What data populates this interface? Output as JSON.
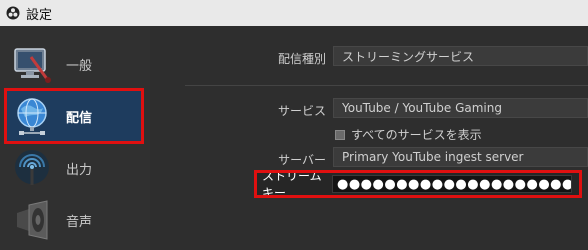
{
  "window": {
    "title": "設定"
  },
  "sidebar": {
    "items": [
      {
        "label": "一般",
        "icon": "monitor-icon"
      },
      {
        "label": "配信",
        "icon": "globe-network-icon",
        "selected": true
      },
      {
        "label": "出力",
        "icon": "broadcast-antenna-icon"
      },
      {
        "label": "音声",
        "icon": "speaker-icon"
      }
    ]
  },
  "stream": {
    "type_label": "配信種別",
    "type_value": "ストリーミングサービス",
    "service_label": "サービス",
    "service_value": "YouTube / YouTube Gaming",
    "show_all_label": "すべてのサービスを表示",
    "server_label": "サーバー",
    "server_value": "Primary YouTube ingest server",
    "key_label": "ストリームキー",
    "key_value": "●●●●●●●●●●●●●●●●●●●●●"
  },
  "colors": {
    "highlight": "#e01010",
    "selected_bg": "#1e3c5e"
  }
}
